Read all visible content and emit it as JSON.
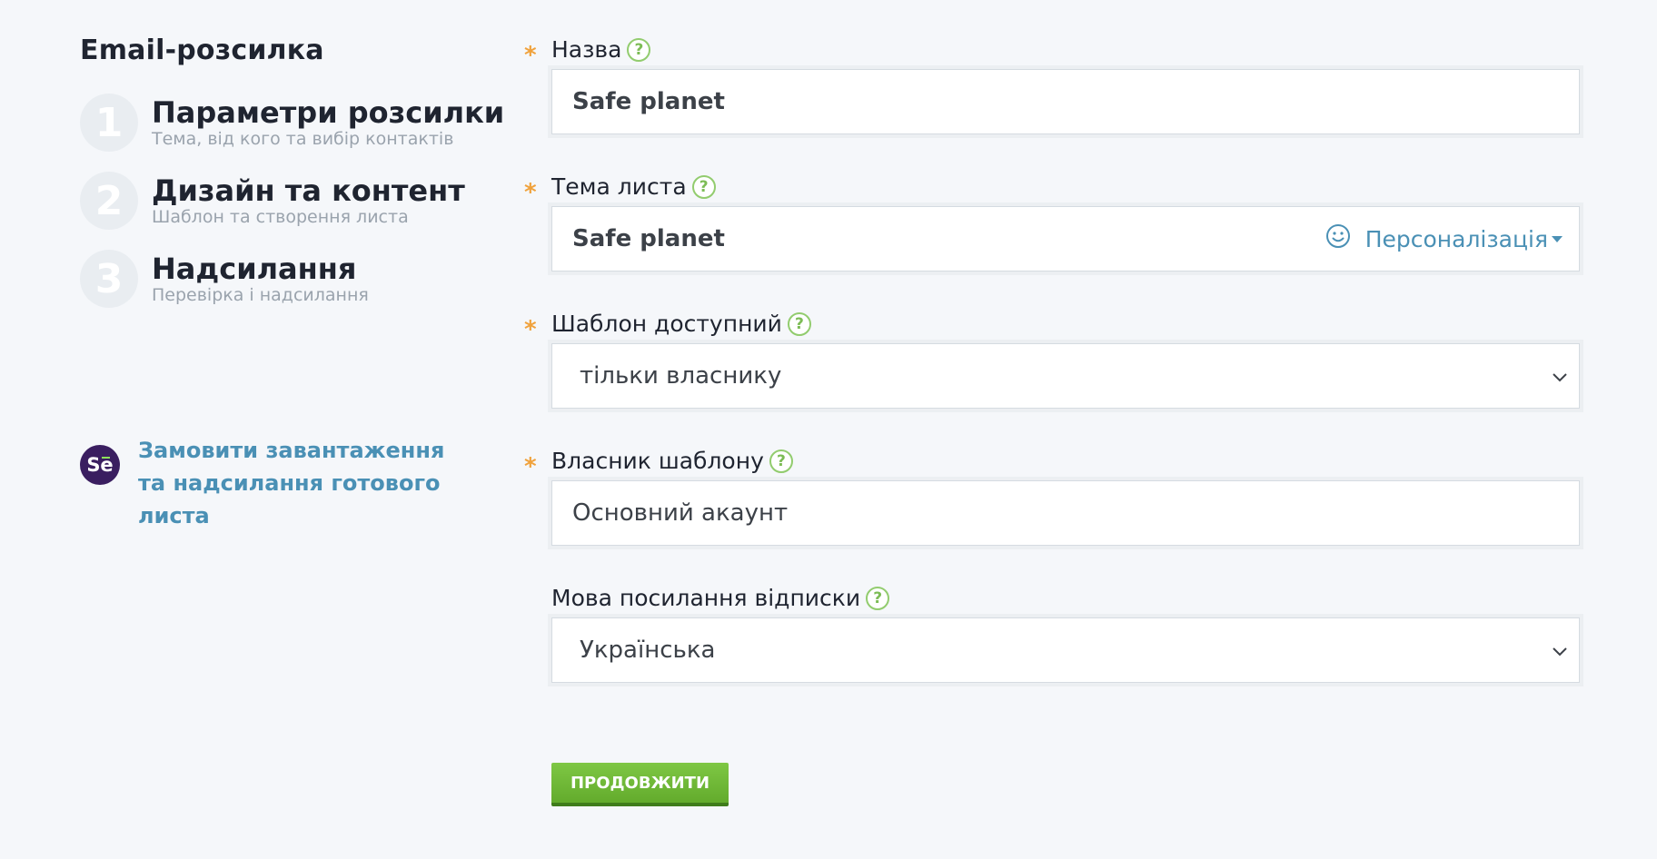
{
  "sidebar": {
    "title": "Email-розсилка",
    "steps": [
      {
        "number": "1",
        "title": "Параметри розсилки",
        "subtitle": "Тема, від кого та вибір контактів"
      },
      {
        "number": "2",
        "title": "Дизайн та контент",
        "subtitle": "Шаблон та створення листа"
      },
      {
        "number": "3",
        "title": "Надсилання",
        "subtitle": "Перевірка і надсилання"
      }
    ],
    "order_link": {
      "logo_text": "Se",
      "text": "Замовити завантаження та надсилання готового листа"
    }
  },
  "form": {
    "name": {
      "label": "Назва",
      "required_mark": "*",
      "help": "?",
      "value": "Safe planet"
    },
    "subject": {
      "label": "Тема листа",
      "required_mark": "*",
      "help": "?",
      "value": "Safe planet",
      "personalization_label": "Персоналізація",
      "emoji_icon": "smile-icon"
    },
    "template_access": {
      "label": "Шаблон доступний",
      "required_mark": "*",
      "help": "?",
      "value": "тільки власнику"
    },
    "template_owner": {
      "label": "Власник шаблону",
      "required_mark": "*",
      "help": "?",
      "value": "Основний акаунт"
    },
    "unsubscribe_language": {
      "label": "Мова посилання відписки",
      "help": "?",
      "value": "Українська"
    }
  },
  "continue_button": "ПРОДОВЖИТИ",
  "colors": {
    "accent_green": "#6bb535",
    "link_blue": "#4a90b5",
    "required_orange": "#f0a23c",
    "logo_purple": "#3a1e60"
  }
}
